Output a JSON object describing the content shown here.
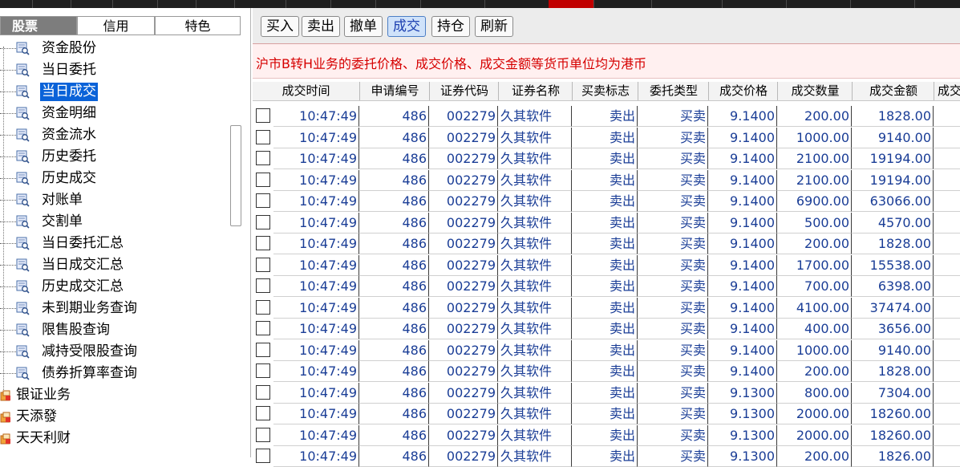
{
  "left": {
    "tabs": [
      "股票",
      "信用",
      "特色"
    ],
    "tree": [
      {
        "label": "资金股份",
        "icon": "query-icon"
      },
      {
        "label": "当日委托",
        "icon": "query-icon"
      },
      {
        "label": "当日成交",
        "icon": "query-icon",
        "selected": true
      },
      {
        "label": "资金明细",
        "icon": "query-icon"
      },
      {
        "label": "资金流水",
        "icon": "query-icon"
      },
      {
        "label": "历史委托",
        "icon": "query-icon"
      },
      {
        "label": "历史成交",
        "icon": "query-icon"
      },
      {
        "label": "对账单",
        "icon": "query-icon"
      },
      {
        "label": "交割单",
        "icon": "query-icon"
      },
      {
        "label": "当日委托汇总",
        "icon": "query-icon"
      },
      {
        "label": "当日成交汇总",
        "icon": "query-icon"
      },
      {
        "label": "历史成交汇总",
        "icon": "query-icon"
      },
      {
        "label": "未到期业务查询",
        "icon": "query-icon"
      },
      {
        "label": "限售股查询",
        "icon": "query-icon"
      },
      {
        "label": "减持受限股查询",
        "icon": "query-icon"
      },
      {
        "label": "债券折算率查询",
        "icon": "query-icon"
      },
      {
        "label": "银证业务",
        "icon": "folder-icon",
        "top": true
      },
      {
        "label": "天添發",
        "icon": "folder-icon",
        "top": true
      },
      {
        "label": "天天利财",
        "icon": "folder-icon",
        "top": true
      }
    ]
  },
  "toolbar": {
    "buttons": [
      "买入",
      "卖出",
      "撤单",
      "成交",
      "持仓",
      "刷新"
    ],
    "active": "成交"
  },
  "notice": "沪市B转H业务的委托价格、成交价格、成交金额等货币单位均为港币",
  "table": {
    "columns": [
      "成交时间",
      "申请编号",
      "证券代码",
      "证券名称",
      "买卖标志",
      "委托类型",
      "成交价格",
      "成交数量",
      "成交金额",
      "成交"
    ],
    "rows": [
      [
        "10:47:49",
        "486",
        "002279",
        "久其软件",
        "卖出",
        "买卖",
        "9.1400",
        "200.00",
        "1828.00"
      ],
      [
        "10:47:49",
        "486",
        "002279",
        "久其软件",
        "卖出",
        "买卖",
        "9.1400",
        "1000.00",
        "9140.00"
      ],
      [
        "10:47:49",
        "486",
        "002279",
        "久其软件",
        "卖出",
        "买卖",
        "9.1400",
        "2100.00",
        "19194.00"
      ],
      [
        "10:47:49",
        "486",
        "002279",
        "久其软件",
        "卖出",
        "买卖",
        "9.1400",
        "2100.00",
        "19194.00"
      ],
      [
        "10:47:49",
        "486",
        "002279",
        "久其软件",
        "卖出",
        "买卖",
        "9.1400",
        "6900.00",
        "63066.00"
      ],
      [
        "10:47:49",
        "486",
        "002279",
        "久其软件",
        "卖出",
        "买卖",
        "9.1400",
        "500.00",
        "4570.00"
      ],
      [
        "10:47:49",
        "486",
        "002279",
        "久其软件",
        "卖出",
        "买卖",
        "9.1400",
        "200.00",
        "1828.00"
      ],
      [
        "10:47:49",
        "486",
        "002279",
        "久其软件",
        "卖出",
        "买卖",
        "9.1400",
        "1700.00",
        "15538.00"
      ],
      [
        "10:47:49",
        "486",
        "002279",
        "久其软件",
        "卖出",
        "买卖",
        "9.1400",
        "700.00",
        "6398.00"
      ],
      [
        "10:47:49",
        "486",
        "002279",
        "久其软件",
        "卖出",
        "买卖",
        "9.1400",
        "4100.00",
        "37474.00"
      ],
      [
        "10:47:49",
        "486",
        "002279",
        "久其软件",
        "卖出",
        "买卖",
        "9.1400",
        "400.00",
        "3656.00"
      ],
      [
        "10:47:49",
        "486",
        "002279",
        "久其软件",
        "卖出",
        "买卖",
        "9.1400",
        "1000.00",
        "9140.00"
      ],
      [
        "10:47:49",
        "486",
        "002279",
        "久其软件",
        "卖出",
        "买卖",
        "9.1400",
        "200.00",
        "1828.00"
      ],
      [
        "10:47:49",
        "486",
        "002279",
        "久其软件",
        "卖出",
        "买卖",
        "9.1300",
        "800.00",
        "7304.00"
      ],
      [
        "10:47:49",
        "486",
        "002279",
        "久其软件",
        "卖出",
        "买卖",
        "9.1300",
        "2000.00",
        "18260.00"
      ],
      [
        "10:47:49",
        "486",
        "002279",
        "久其软件",
        "卖出",
        "买卖",
        "9.1300",
        "2000.00",
        "18260.00"
      ],
      [
        "10:47:49",
        "486",
        "002279",
        "久其软件",
        "卖出",
        "买卖",
        "9.1300",
        "200.00",
        "1826.00"
      ]
    ]
  },
  "colors": {
    "selected": "#0a62d8",
    "notice_text": "#d60000",
    "cell_text": "#1a3d96"
  }
}
